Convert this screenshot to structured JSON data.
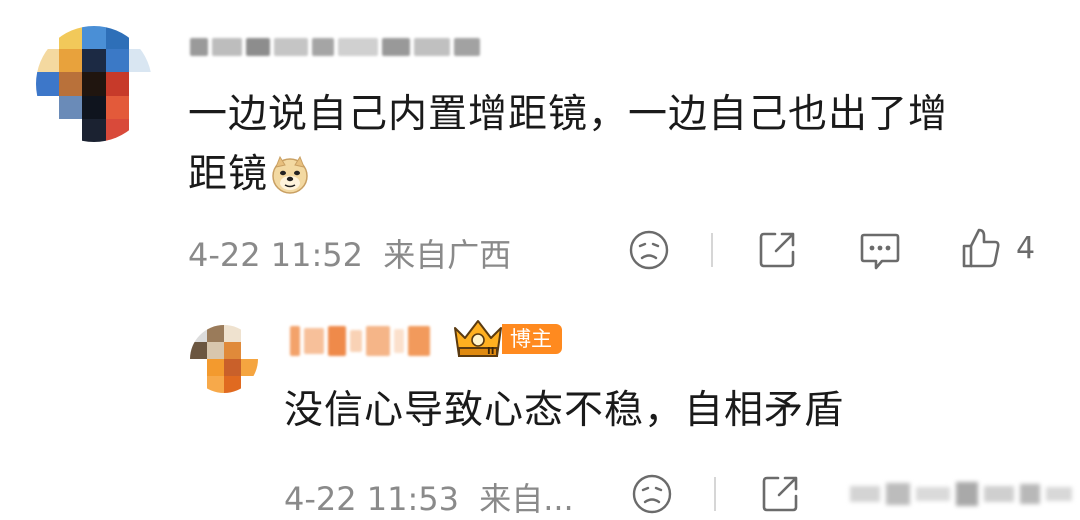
{
  "comment": {
    "text_line1": "一边说自己内置增距镜，一边自己也出了增",
    "text_line2": "距镜",
    "emoji": "doge-emoji",
    "date": "4-22 11:52",
    "location": "来自广西",
    "like_count": "4",
    "avatar_colors": [
      "#ffffff",
      "#f2c95a",
      "#4a8fd6",
      "#2e6fb8",
      "#ffffff",
      "#f4d9a0",
      "#e8a23c",
      "#1c2a44",
      "#3b79c6",
      "#d9e6f2",
      "#3d77c9",
      "#b9713a",
      "#20150f",
      "#c73a2a",
      "#ffffff",
      "#ffffff",
      "#6a8bb8",
      "#0f141e",
      "#e35a3a",
      "#ffffff",
      "#ffffff",
      "#ffffff",
      "#1b2231",
      "#d94a3a",
      "#ffffff"
    ]
  },
  "reply": {
    "badge_label": "博主",
    "badge_level": "II",
    "text": "没信心导致心态不稳，自相矛盾",
    "date": "4-22 11:53",
    "location": "来自...",
    "avatar_colors": [
      "#dcdcdc",
      "#9a7b5a",
      "#efe2cf",
      "#ffffff",
      "#6b5640",
      "#d8c6ad",
      "#e08a3a",
      "#ffffff",
      "#ffffff",
      "#f39a2e",
      "#c9602a",
      "#f5a540",
      "#ffffff",
      "#f7a94a",
      "#e06a20",
      "#ffffff"
    ]
  },
  "colors": {
    "text": "#1a1a1a",
    "meta": "#8a8a8a",
    "icon": "#6b6b6b",
    "badge": "#ff8a1f"
  }
}
